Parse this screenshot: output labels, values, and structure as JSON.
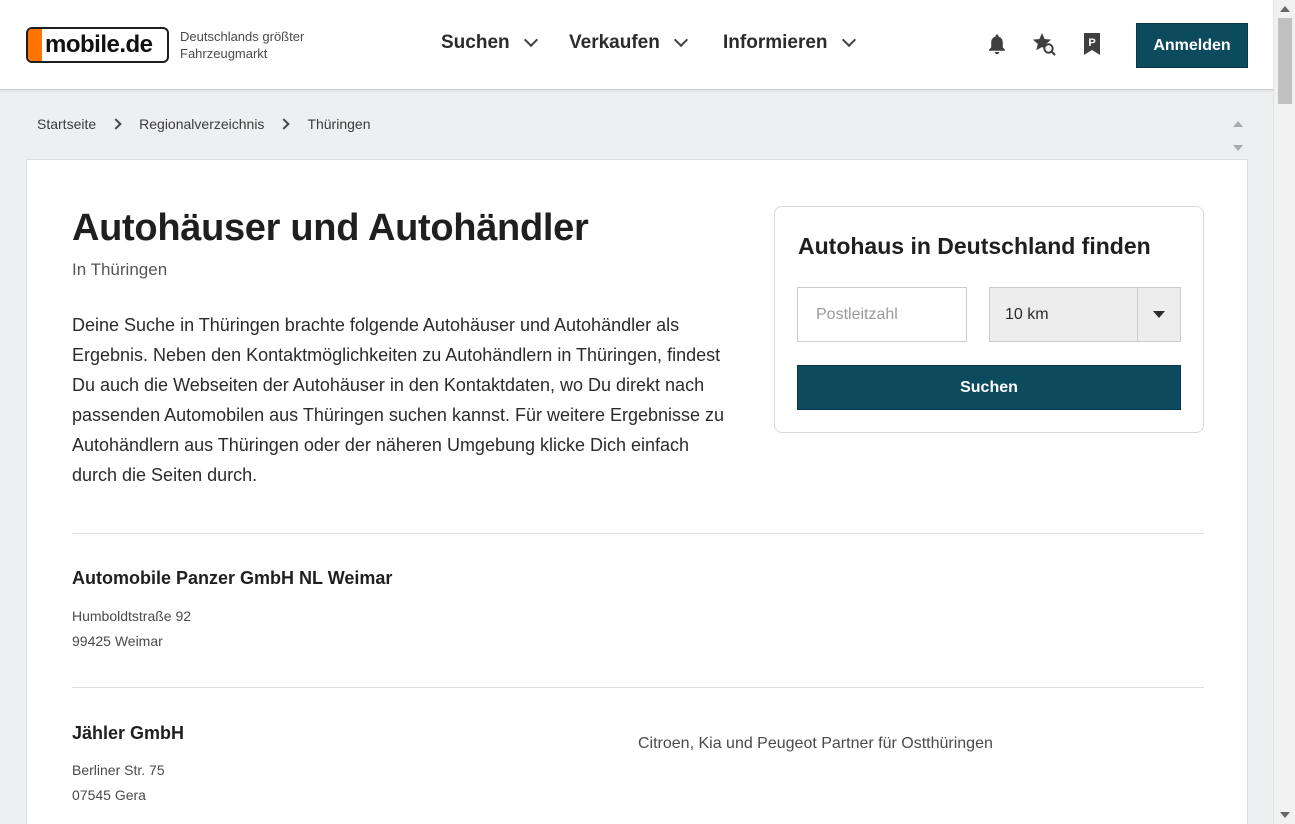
{
  "header": {
    "logo_text": "mobile.de",
    "tagline_line1": "Deutschlands größter",
    "tagline_line2": "Fahrzeugmarkt",
    "nav": [
      {
        "label": "Suchen"
      },
      {
        "label": "Verkaufen"
      },
      {
        "label": "Informieren"
      }
    ],
    "icons": [
      "bell-icon",
      "saved-search-star-icon",
      "parking-icon"
    ],
    "login_label": "Anmelden"
  },
  "breadcrumb": [
    "Startseite",
    "Regionalverzeichnis",
    "Thüringen"
  ],
  "main": {
    "title": "Autohäuser und Autohändler",
    "subtitle": "In Thüringen",
    "description": "Deine Suche in Thüringen brachte folgende Autohäuser und Autohändler als Ergebnis. Neben den Kontaktmöglichkeiten zu Autohändlern in Thüringen, findest Du auch die Webseiten der Autohäuser in den Kontaktdaten, wo Du direkt nach passenden Automobilen aus Thüringen suchen kannst. Für weitere Ergebnisse zu Autohändlern aus Thüringen oder der näheren Umgebung klicke Dich einfach durch die Seiten durch."
  },
  "search": {
    "title": "Autohaus in Deutschland finden",
    "plz_placeholder": "Postleitzahl",
    "plz_value": "",
    "radius_value": "10 km",
    "button_label": "Suchen"
  },
  "dealers": [
    {
      "name": "Automobile Panzer GmbH NL Weimar",
      "street": "Humboldtstraße 92",
      "city": "99425 Weimar",
      "tagline": ""
    },
    {
      "name": "Jähler GmbH",
      "street": "Berliner Str. 75",
      "city": "07545 Gera",
      "tagline": "Citroen, Kia und Peugeot Partner für Ostthüringen"
    }
  ],
  "colors": {
    "primary": "#0c4a5e",
    "logo_accent": "#ff7500",
    "background": "#eeeff1"
  }
}
